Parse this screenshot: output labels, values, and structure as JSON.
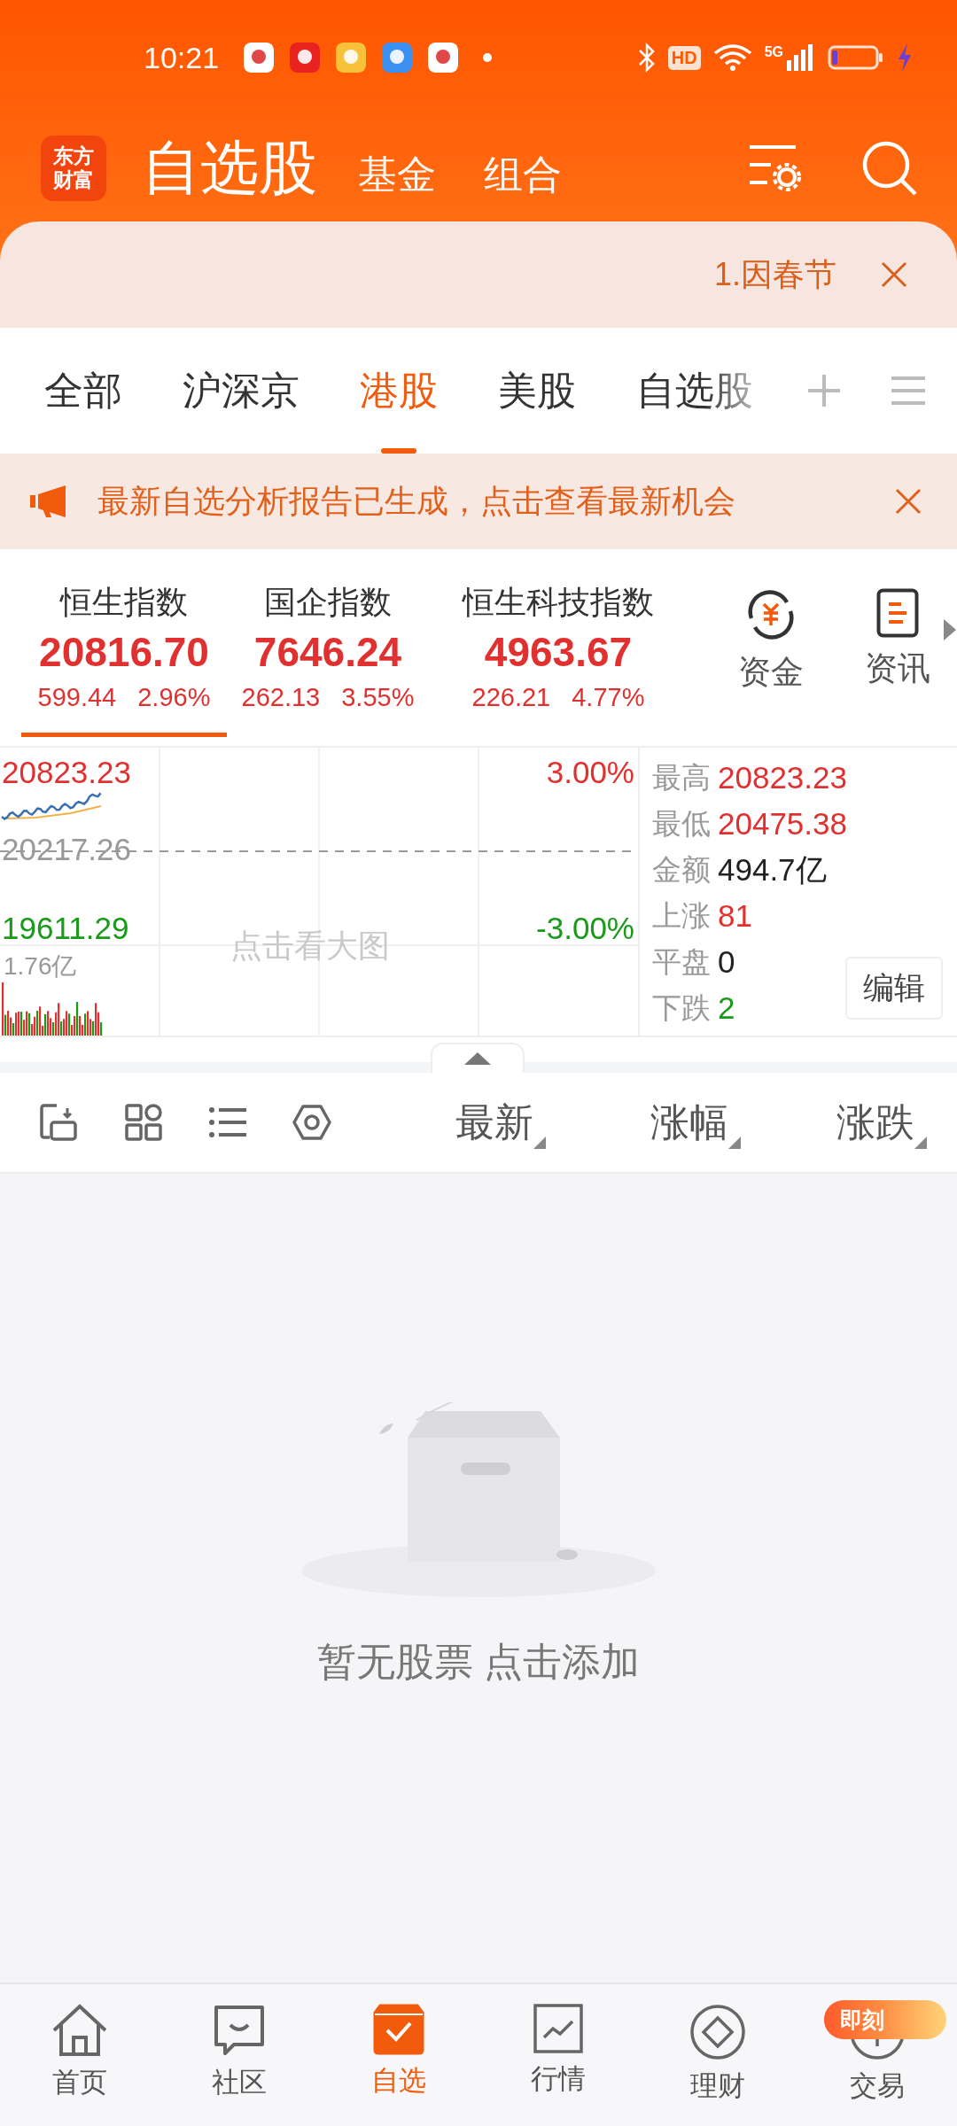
{
  "status_bar": {
    "time": "10:21",
    "hd_label": "HD",
    "network_label": "5G"
  },
  "header": {
    "logo_lines": [
      "东方",
      "财富"
    ],
    "tabs": [
      {
        "label": "自选股",
        "selected": true
      },
      {
        "label": "基金",
        "selected": false
      },
      {
        "label": "组合",
        "selected": false
      }
    ]
  },
  "notice": {
    "text": "1.因春节"
  },
  "market_tabs": [
    {
      "label": "全部",
      "selected": false
    },
    {
      "label": "沪深京",
      "selected": false
    },
    {
      "label": "港股",
      "selected": true
    },
    {
      "label": "美股",
      "selected": false
    },
    {
      "label": "自选股",
      "selected": false
    }
  ],
  "announcement": {
    "text": "最新自选分析报告已生成，点击查看最新机会"
  },
  "indices": [
    {
      "name": "恒生指数",
      "value": "20816.70",
      "change": "599.44",
      "percent": "2.96%",
      "selected": true
    },
    {
      "name": "国企指数",
      "value": "7646.24",
      "change": "262.13",
      "percent": "3.55%",
      "selected": false
    },
    {
      "name": "恒生科技指数",
      "value": "4963.67",
      "change": "226.21",
      "percent": "4.77%",
      "selected": false
    }
  ],
  "shortcuts": [
    {
      "label": "资金",
      "kind": "fund"
    },
    {
      "label": "资讯",
      "kind": "news"
    }
  ],
  "chart": {
    "high_label": "20823.23",
    "high_pct": "3.00%",
    "base_label": "20217.26",
    "low_label": "19611.29",
    "low_pct": "-3.00%",
    "hint": "点击看大图",
    "volume": "1.76亿"
  },
  "stats": [
    {
      "label": "最高",
      "value": "20823.23",
      "color": "#e0302f"
    },
    {
      "label": "最低",
      "value": "20475.38",
      "color": "#e0302f"
    },
    {
      "label": "金额",
      "value": "494.7亿",
      "color": "#222222"
    },
    {
      "label": "上涨",
      "value": "81",
      "color": "#e0302f"
    },
    {
      "label": "平盘",
      "value": "0",
      "color": "#222222"
    },
    {
      "label": "下跌",
      "value": "2",
      "color": "#1a9a1a"
    }
  ],
  "edit_button": "编辑",
  "sort_columns": [
    {
      "label": "最新"
    },
    {
      "label": "涨幅"
    },
    {
      "label": "涨跌"
    }
  ],
  "empty_state": {
    "text": "暂无股票 点击添加"
  },
  "bottom_nav": [
    {
      "label": "首页",
      "kind": "home",
      "selected": false
    },
    {
      "label": "社区",
      "kind": "community",
      "selected": false
    },
    {
      "label": "自选",
      "kind": "watchlist",
      "selected": true
    },
    {
      "label": "行情",
      "kind": "market",
      "selected": false
    },
    {
      "label": "理财",
      "kind": "wealth",
      "selected": false
    },
    {
      "label": "交易",
      "kind": "trade",
      "selected": false
    }
  ],
  "badge": "即刻"
}
